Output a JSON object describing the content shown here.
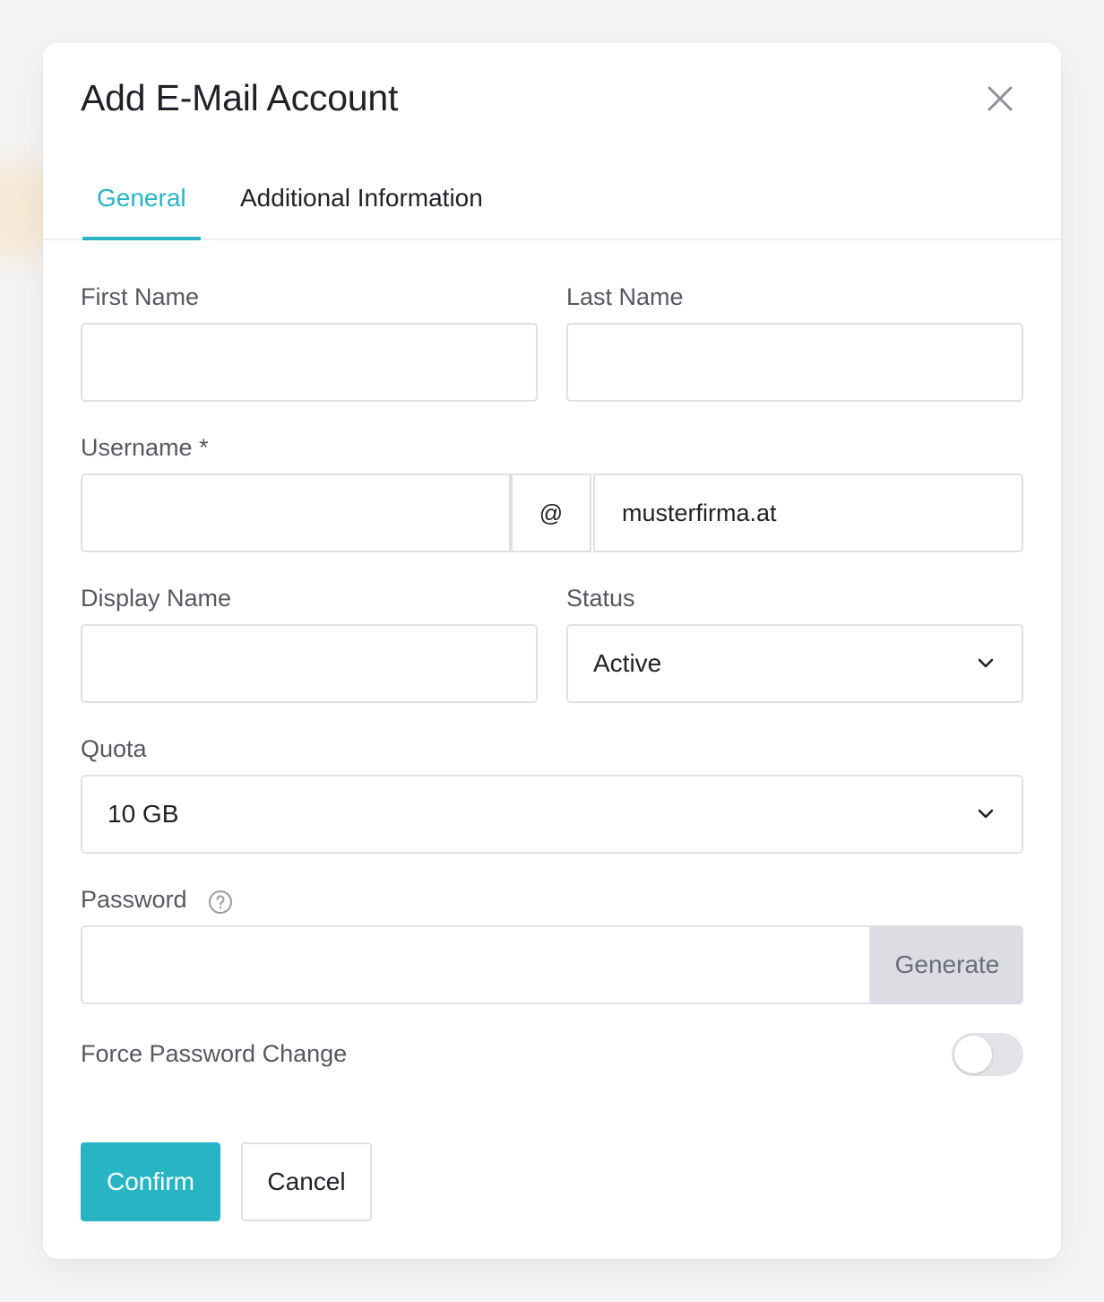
{
  "dialog": {
    "title": "Add E-Mail Account"
  },
  "tabs": [
    {
      "label": "General",
      "active": true
    },
    {
      "label": "Additional Information",
      "active": false
    }
  ],
  "form": {
    "first_name": {
      "label": "First Name",
      "value": ""
    },
    "last_name": {
      "label": "Last Name",
      "value": ""
    },
    "username": {
      "label": "Username *",
      "value": "",
      "at_symbol": "@",
      "domain": "musterfirma.at"
    },
    "display_name": {
      "label": "Display Name",
      "value": ""
    },
    "status": {
      "label": "Status",
      "selected": "Active"
    },
    "quota": {
      "label": "Quota",
      "selected": "10 GB"
    },
    "password": {
      "label": "Password",
      "value": "",
      "generate_label": "Generate"
    },
    "force_password_change": {
      "label": "Force Password Change",
      "enabled": false
    }
  },
  "actions": {
    "confirm_label": "Confirm",
    "cancel_label": "Cancel"
  },
  "colors": {
    "accent": "#27b5c4",
    "border": "#dfe1e5",
    "label": "#55585f"
  },
  "icons": {
    "close": "close-icon",
    "chevron": "chevron-down-icon",
    "help": "help-circle-icon"
  }
}
